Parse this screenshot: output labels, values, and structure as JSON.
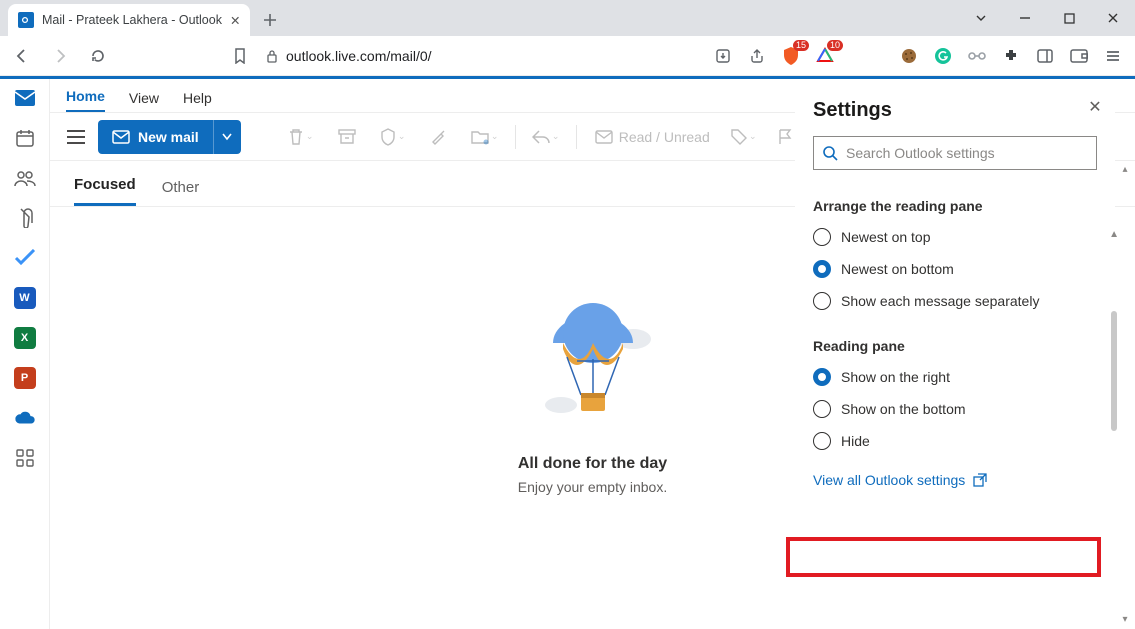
{
  "browser": {
    "tab_title": "Mail - Prateek Lakhera - Outlook",
    "url": "outlook.live.com/mail/0/",
    "shield_badge": "15",
    "triangle_badge": "10"
  },
  "ribbon": {
    "home": "Home",
    "view": "View",
    "help": "Help"
  },
  "cmd": {
    "new_mail": "New mail",
    "read_unread": "Read / Unread"
  },
  "inbox": {
    "focused": "Focused",
    "other": "Other",
    "empty_title": "All done for the day",
    "empty_sub": "Enjoy your empty inbox."
  },
  "settings": {
    "title": "Settings",
    "search_placeholder": "Search Outlook settings",
    "group1": "Arrange the reading pane",
    "opt_newest_top": "Newest on top",
    "opt_newest_bottom": "Newest on bottom",
    "opt_separate": "Show each message separately",
    "group2": "Reading pane",
    "opt_right": "Show on the right",
    "opt_bottom": "Show on the bottom",
    "opt_hide": "Hide",
    "view_all": "View all Outlook settings"
  }
}
